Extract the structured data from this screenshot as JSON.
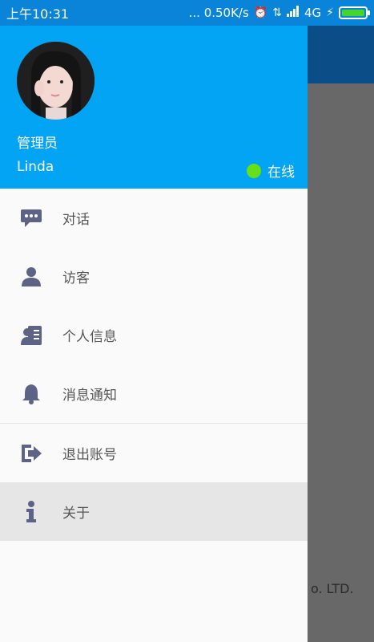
{
  "status_bar": {
    "time": "上午10:31",
    "speed": "... 0.50K/s",
    "network": "4G",
    "battery_percent": 100
  },
  "drawer": {
    "header": {
      "role": "管理员",
      "username": "Linda",
      "status": "在线",
      "status_color": "#66e019",
      "background_color": "#04a4f4"
    },
    "menu": [
      {
        "label": "对话",
        "icon": "chat-bubble-icon"
      },
      {
        "label": "访客",
        "icon": "user-icon"
      },
      {
        "label": "个人信息",
        "icon": "id-card-icon"
      },
      {
        "label": "消息通知",
        "icon": "bell-icon"
      },
      {
        "label": "退出账号",
        "icon": "sign-out-icon"
      },
      {
        "label": "关于",
        "icon": "info-icon",
        "selected": true
      }
    ]
  },
  "background_app": {
    "footer_text": "o. LTD."
  },
  "colors": {
    "icon": "#5d6386",
    "status_bar": "#0a84d8",
    "app_bar": "#0b4d87"
  }
}
